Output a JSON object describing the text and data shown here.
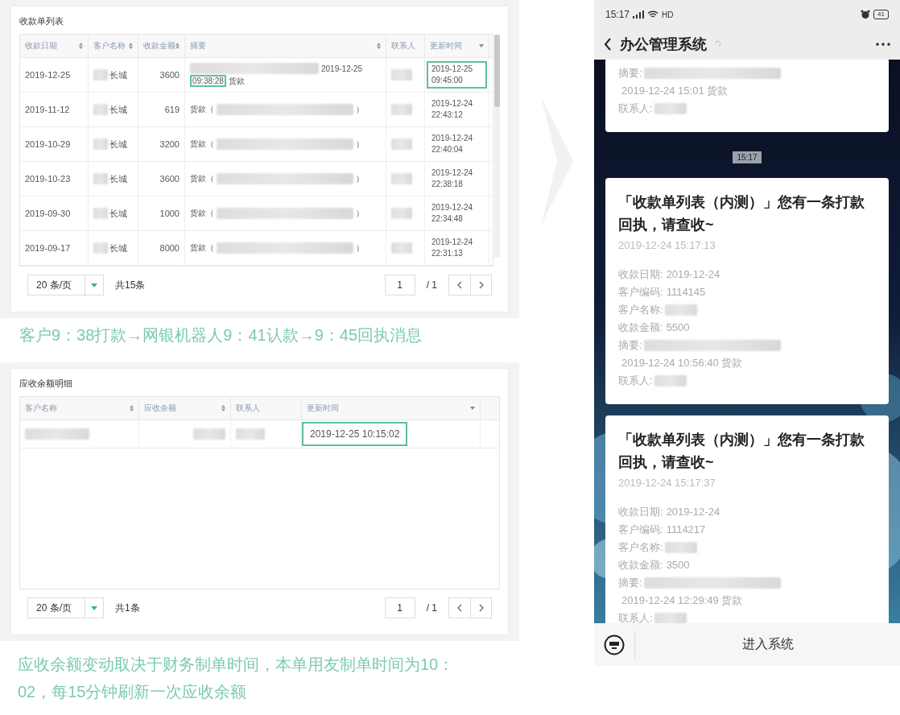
{
  "receipts_panel": {
    "title": "收款单列表",
    "columns": [
      {
        "label": "收款日期",
        "sortable": true,
        "sorted": false
      },
      {
        "label": "客户名称",
        "sortable": true,
        "sorted": false
      },
      {
        "label": "收款金额",
        "sortable": true,
        "sorted": false
      },
      {
        "label": "摘要",
        "sortable": true,
        "sorted": false
      },
      {
        "label": "联系人",
        "sortable": false,
        "sorted": false
      },
      {
        "label": "更新时间",
        "sortable": false,
        "sorted": true
      }
    ],
    "rows": [
      {
        "date": "2019-12-25",
        "customer": "长城",
        "amount": "3600",
        "summary": [
          {
            "kind": "blur"
          },
          {
            "kind": "text",
            "text": "2019-12-25"
          },
          {
            "kind": "highlight",
            "text": "09:38:28"
          },
          {
            "kind": "text",
            "text": "货款"
          }
        ],
        "updated": "2019-12-25 09:45:00",
        "highlighted": true
      },
      {
        "date": "2019-11-12",
        "customer": "长城",
        "amount": "619",
        "summary": [
          {
            "kind": "text",
            "text": "货款（"
          },
          {
            "kind": "blur"
          },
          {
            "kind": "text",
            "text": "）"
          }
        ],
        "updated": "2019-12-24 22:43:12",
        "highlighted": false
      },
      {
        "date": "2019-10-29",
        "customer": "长城",
        "amount": "3200",
        "summary": [
          {
            "kind": "text",
            "text": "货款（"
          },
          {
            "kind": "blur"
          },
          {
            "kind": "text",
            "text": "）"
          }
        ],
        "updated": "2019-12-24 22:40:04",
        "highlighted": false
      },
      {
        "date": "2019-10-23",
        "customer": "长城",
        "amount": "3600",
        "summary": [
          {
            "kind": "text",
            "text": "货款（"
          },
          {
            "kind": "blur"
          },
          {
            "kind": "text",
            "text": "）"
          }
        ],
        "updated": "2019-12-24 22:38:18",
        "highlighted": false
      },
      {
        "date": "2019-09-30",
        "customer": "长城",
        "amount": "1000",
        "summary": [
          {
            "kind": "text",
            "text": "货款（"
          },
          {
            "kind": "blur"
          },
          {
            "kind": "text",
            "text": "）"
          }
        ],
        "updated": "2019-12-24 22:34:48",
        "highlighted": false
      },
      {
        "date": "2019-09-17",
        "customer": "长城",
        "amount": "8000",
        "summary": [
          {
            "kind": "text",
            "text": "货款（"
          },
          {
            "kind": "blur"
          },
          {
            "kind": "text",
            "text": "）"
          }
        ],
        "updated": "2019-12-24 22:31:13",
        "highlighted": false
      }
    ],
    "pagination": {
      "page_size": "20 条/页",
      "total": "共15条",
      "page": "1",
      "pages": "/ 1"
    }
  },
  "caption_1": "客户9：38打款→网银机器人9：41认款→9：45回执消息",
  "balance_panel": {
    "title": "应收余额明细",
    "columns": [
      {
        "label": "客户名称",
        "sortable": true,
        "sorted": false
      },
      {
        "label": "应收余额",
        "sortable": true,
        "sorted": false
      },
      {
        "label": "联系人",
        "sortable": false,
        "sorted": false
      },
      {
        "label": "更新时间",
        "sortable": false,
        "sorted": true
      }
    ],
    "rows": [
      {
        "updated": "2019-12-25 10:15:02",
        "highlighted": true
      }
    ],
    "pagination": {
      "page_size": "20 条/页",
      "total": "共1条",
      "page": "1",
      "pages": "/ 1"
    }
  },
  "caption_2": "应收余额变动取决于财务制单时间，本单用友制单时间为10：02，每15分钟刷新一次应收余额",
  "phone": {
    "status_bar": {
      "time": "15:17",
      "network": "HD",
      "battery": "41"
    },
    "nav": {
      "title": "办公管理系统"
    },
    "messages": [
      {
        "kind": "partial",
        "fields": [
          {
            "label": "摘要:",
            "blur": true,
            "value": "2019-12-24 15:01 货款"
          },
          {
            "label": "联系人:",
            "blur": true
          }
        ]
      },
      {
        "kind": "time",
        "time": "15:17"
      },
      {
        "kind": "card",
        "title": "「收款单列表（内测）」您有一条打款回执，请查收~",
        "time": "2019-12-24 15:17:13",
        "fields": [
          {
            "label": "收款日期:",
            "value": "2019-12-24"
          },
          {
            "label": "客户编码:",
            "value": "1114145"
          },
          {
            "label": "客户名称:",
            "blur": true
          },
          {
            "label": "收款金额:",
            "value": "5500"
          },
          {
            "label": "摘要:",
            "blur": true,
            "value": "2019-12-24 10:56:40 货款"
          },
          {
            "label": "联系人:",
            "blur": true
          }
        ]
      },
      {
        "kind": "card",
        "title": "「收款单列表（内测）」您有一条打款回执，请查收~",
        "time": "2019-12-24 15:17:37",
        "fields": [
          {
            "label": "收款日期:",
            "value": "2019-12-24"
          },
          {
            "label": "客户编码:",
            "value": "1114217"
          },
          {
            "label": "客户名称:",
            "blur": true
          },
          {
            "label": "收款金额:",
            "value": "3500"
          },
          {
            "label": "摘要:",
            "blur": true,
            "value": "2019-12-24 12:29:49 货款"
          },
          {
            "label": "联系人:",
            "blur": true
          }
        ]
      }
    ],
    "bottom_bar": {
      "menu": "进入系统"
    }
  }
}
